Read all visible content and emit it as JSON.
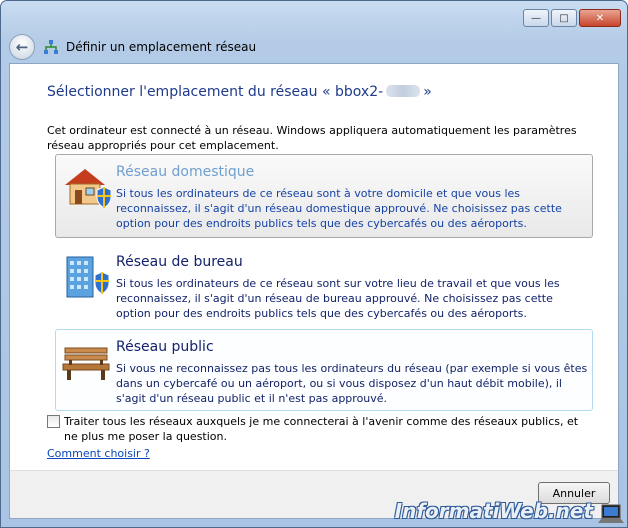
{
  "window": {
    "title": "Définir un emplacement réseau",
    "minimize_glyph": "—",
    "maximize_glyph": "□",
    "close_glyph": "✕"
  },
  "heading": {
    "prefix": "Sélectionner l'emplacement du réseau « bbox2-",
    "suffix": "»"
  },
  "intro": "Cet ordinateur est connecté à un réseau. Windows appliquera automatiquement les paramètres réseau appropriés pour cet emplacement.",
  "options": [
    {
      "title": "Réseau domestique",
      "description": "Si tous les ordinateurs de ce réseau sont à votre domicile et que vous les reconnaissez, il s'agit d'un réseau domestique approuvé. Ne choisissez pas cette option pour des endroits publics tels que des cybercafés ou des aéroports.",
      "icon": "home-network-icon"
    },
    {
      "title": "Réseau de bureau",
      "description": "Si tous les ordinateurs de ce réseau sont sur votre lieu de travail et que vous les reconnaissez, il s'agit d'un réseau de bureau approuvé. Ne choisissez pas cette option pour des endroits publics tels que des cybercafés ou des aéroports.",
      "icon": "work-network-icon"
    },
    {
      "title": "Réseau public",
      "description": "Si vous ne reconnaissez pas tous les ordinateurs du réseau (par exemple si vous êtes dans un cybercafé ou un aéroport, ou si vous disposez d'un haut débit mobile), il s'agit d'un réseau public et il n'est pas approuvé.",
      "icon": "public-network-bench-icon"
    }
  ],
  "checkbox": {
    "label": "Traiter tous les réseaux auxquels je me connecterai à l'avenir comme des réseaux publics, et ne plus me poser la question.",
    "checked": false
  },
  "help_link": "Comment choisir ?",
  "buttons": {
    "cancel": "Annuler"
  },
  "watermark": "InformatiWeb.net",
  "colors": {
    "heading": "#1e3a8a",
    "link": "#0b47b8",
    "selected_title": "#6f9fcf"
  }
}
